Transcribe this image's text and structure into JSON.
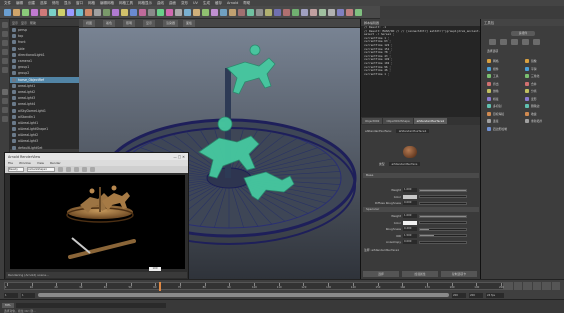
{
  "menubar": {
    "items": [
      "文件",
      "编辑",
      "创建",
      "选择",
      "修改",
      "显示",
      "窗口",
      "网格",
      "编辑网格",
      "网格工具",
      "网格显示",
      "曲线",
      "曲面",
      "变形",
      "UV",
      "生成",
      "缓存",
      "Arnold",
      "帮助"
    ]
  },
  "shelf": {
    "tab_label": "Mel"
  },
  "outliner": {
    "header": [
      "显示",
      "显示",
      "帮助"
    ],
    "items": [
      {
        "label": "persp",
        "selected": false
      },
      {
        "label": "top",
        "selected": false
      },
      {
        "label": "front",
        "selected": false
      },
      {
        "label": "side",
        "selected": false
      },
      {
        "label": "directionalLight1",
        "selected": false
      },
      {
        "label": "camera1",
        "selected": false
      },
      {
        "label": "group1",
        "selected": false
      },
      {
        "label": "group2",
        "selected": false
      },
      {
        "label": "horse_ObjectRef",
        "selected": true
      },
      {
        "label": "areaLight1",
        "selected": false
      },
      {
        "label": "areaLight2",
        "selected": false
      },
      {
        "label": "areaLight3",
        "selected": false
      },
      {
        "label": "areaLight4",
        "selected": false
      },
      {
        "label": "aiSkyDomeLight1",
        "selected": false
      },
      {
        "label": "aiStandIn1",
        "selected": false
      },
      {
        "label": "aiAreaLight1",
        "selected": false
      },
      {
        "label": "aiAreaLightShape1",
        "selected": false
      },
      {
        "label": "aiAreaLight2",
        "selected": false
      },
      {
        "label": "aiAreaLight3",
        "selected": false
      },
      {
        "label": "defaultLightSet",
        "selected": false
      }
    ]
  },
  "viewport": {
    "tabs": [
      "视图",
      "着色",
      "照明",
      "显示",
      "渲染器",
      "面板"
    ]
  },
  "render_view": {
    "title": "Arnold RenderView",
    "menu": [
      "File",
      "Window",
      "View",
      "Render"
    ],
    "camera_select": "Beauty",
    "layer_select": "cameraShape1",
    "status": "Rendering (Arnold) scene...",
    "zoom": "100"
  },
  "script_editor": {
    "title": "脚本编辑器",
    "lines": [
      "// Result: -1",
      "// Result: MASH/DO  //  // [connectAttr] setAttr(\"|group1|drum_ancient.drum_panel\"",
      "select -r horse1 ;",
      "currentTime 1 ;",
      "currentTime 63 ;",
      "currentTime 122 ;",
      "currentTime 151 ;",
      "currentTime 78 ;",
      "currentTime 43 ;",
      "currentTime 149 ;",
      "currentTime 102 ;",
      "currentTime 96 ;",
      "currentTime 46 ;",
      "currentTime 1 ;"
    ]
  },
  "attribute_editor": {
    "tabs": [
      "Object002",
      "Object002Shape",
      "aiStandardSurface1"
    ],
    "node_label": "aiStandardSurface:",
    "node_value": "aiStandardSurface1",
    "type_label": "类型",
    "type_value": "aiStandardSurface",
    "section_base": "Base",
    "base_rows": [
      {
        "label": "Weight",
        "value": "1.000",
        "fill": 100
      },
      {
        "label": "Color",
        "value": "",
        "fill": 0,
        "swatch": "#c9c9c9"
      },
      {
        "label": "Diffuse Roughness",
        "value": "0.000",
        "fill": 0
      },
      {
        "label": "Metalness",
        "value": "0.000",
        "fill": 0
      }
    ],
    "section_specular": "Specular",
    "spec_rows": [
      {
        "label": "Weight",
        "value": "1.000",
        "fill": 100
      },
      {
        "label": "Color",
        "value": "",
        "fill": 0,
        "swatch": "#f2f2f2"
      },
      {
        "label": "Roughness",
        "value": "0.200",
        "fill": 20
      },
      {
        "label": "IOR",
        "value": "1.500",
        "fill": 30
      },
      {
        "label": "Anisotropy",
        "value": "0.000",
        "fill": 0
      }
    ],
    "notes_label": "注释: aiStandardSurface1",
    "buttons": [
      "选择",
      "加载属性",
      "复制选项卡"
    ]
  },
  "modeling_toolkit": {
    "title": "工具包",
    "mode_pill": "多组件",
    "section_select": "选择选项",
    "items_left": [
      "网格",
      "组件",
      "工具",
      "挤出",
      "倒角",
      "桥接",
      "多切割",
      "目标焊接",
      "连接",
      "四边形绘制"
    ],
    "items_right": [
      "镜像",
      "平滑",
      "三角化",
      "合并",
      "分离",
      "变形",
      "删除边",
      "收拢",
      "重新拓扑"
    ]
  },
  "timeline": {
    "ticks": [
      "1",
      "10",
      "20",
      "30",
      "40",
      "50",
      "60",
      "70",
      "80",
      "90",
      "100",
      "110",
      "120",
      "130",
      "140",
      "150",
      "160",
      "170",
      "180",
      "190",
      "200"
    ],
    "current_frame": "1",
    "start": "1",
    "end": "200",
    "range_start": "1",
    "range_end": "200",
    "fps": "24 fps",
    "cursor_fraction": 0.31
  },
  "cmdline": {
    "mel": "MEL",
    "help": "选择对象。按住 Ctrl 键..."
  }
}
